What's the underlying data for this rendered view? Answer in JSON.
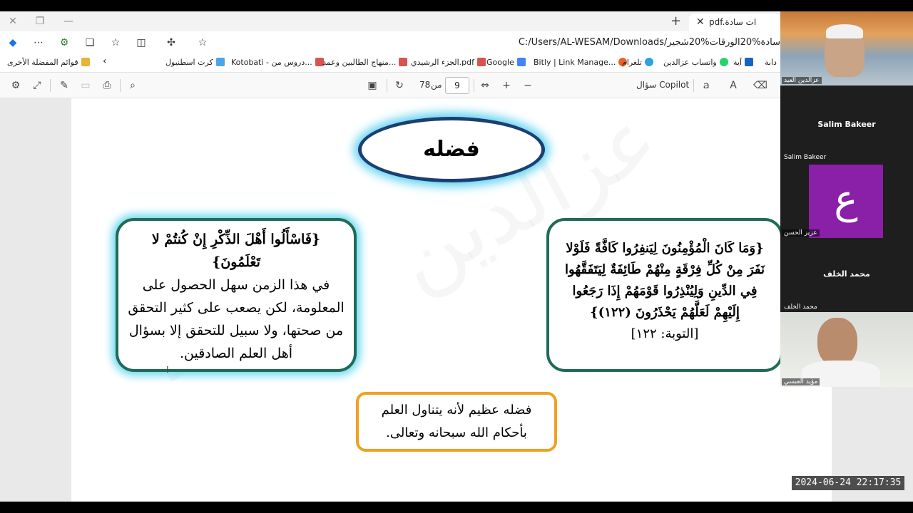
{
  "browser": {
    "tab_title": "pdf.ات سادة",
    "url": "C:/Users/AL-WESAM/Downloads/سادة%20الورقات%20شجير",
    "bookmarks": [
      {
        "label": "قوائم المفضلة الأخرى",
        "color": "#e8b339"
      },
      {
        "label": "كرت اسطنبول",
        "color": "#4aa6e8"
      },
      {
        "label": "Kotobati - دروس من...",
        "color": "#d9534f"
      },
      {
        "label": "منهاج الطالبين وعمد...",
        "color": "#d9534f"
      },
      {
        "label": "الجزء الرشيدي.pdf",
        "color": "#d9534f"
      },
      {
        "label": "Google",
        "color": "#4285f4"
      },
      {
        "label": "Bitly | Link Manage...",
        "color": "#ee6123"
      },
      {
        "label": "تلغرام",
        "color": "#2aa3e0"
      },
      {
        "label": "واتساب عزالدين",
        "color": "#25d366"
      },
      {
        "label": "آية",
        "color": "#1565c0"
      },
      {
        "label": "دابة",
        "color": "#555555"
      }
    ]
  },
  "pdf_toolbar": {
    "current_page": "9",
    "page_of": "من",
    "total_pages": "78",
    "copilot_label": "سؤال Copilot"
  },
  "slide": {
    "title": "فضله",
    "left_box": {
      "verse": "{فَاسْأَلُوا أَهْلَ الذِّكْرِ إِنْ كُنتُمْ لا تَعْلَمُونَ}",
      "text": "في هذا الزمن سهل الحصول على المعلومة، لكن يصعب على كثير التحقق من صحتها، ولا سبيل للتحقق إلا بسؤال أهل العلم الصادقين."
    },
    "right_box": {
      "verse": "{وَمَا كَانَ الْمُؤْمِنُونَ لِيَنفِرُوا كَافَّةً فَلَوْلا نَفَرَ مِنْ كُلِّ فِرْقَةٍ مِنْهُمْ طَائِفَةٌ لِيَتَفَقَّهُوا فِي الدِّينِ وَلِيُنْذِرُوا قَوْمَهُمْ إِذَا رَجَعُوا إِلَيْهِمْ لَعَلَّهُمْ يَحْذَرُونَ (١٢٢)}",
      "reference": "[التوبة: ١٢٢]"
    },
    "bottom_box": "فضله عظيم لأنه يتناول العلم بأحكام الله سبحانه وتعالى."
  },
  "participants": [
    {
      "label": "عزالدين العبد",
      "type": "video"
    },
    {
      "name": "Salim Bakeer",
      "label": "Salim Bakeer",
      "type": "name"
    },
    {
      "avatar_letter": "ع",
      "label": "عزيز الحسن",
      "type": "avatar",
      "color": "#8a1fa8"
    },
    {
      "name": "محمد الخلف",
      "label": "محمد الخلف",
      "type": "name"
    },
    {
      "label": "مؤيد العبسي",
      "type": "video"
    }
  ],
  "timestamp": "2024-06-24  22:17:35"
}
